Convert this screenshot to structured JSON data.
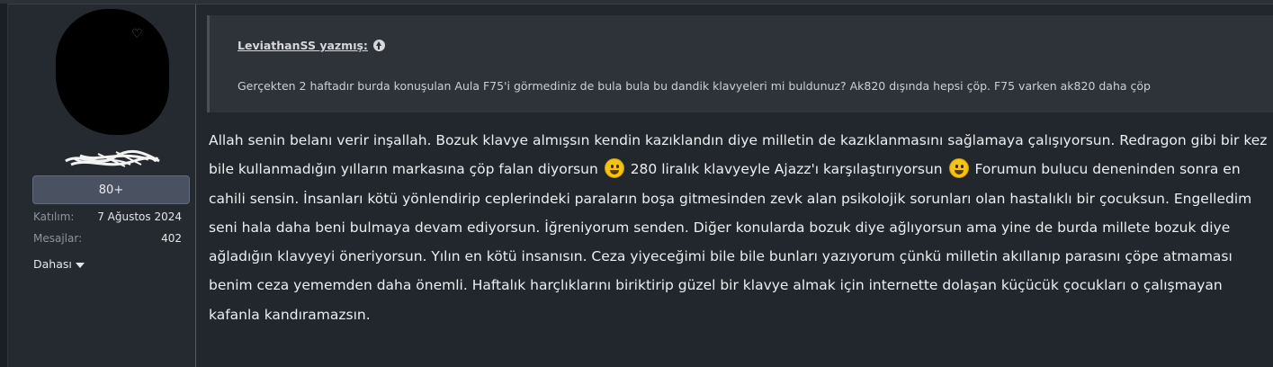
{
  "user": {
    "badge": "80+",
    "stats": [
      {
        "label": "Katılım:",
        "value": "7 Ağustos 2024"
      },
      {
        "label": "Mesajlar:",
        "value": "402"
      }
    ],
    "more_label": "Dahası"
  },
  "quote": {
    "author": "LeviathanSS yazmış:",
    "text": "Gerçekten 2 haftadır burda konuşulan Aula F75'i görmediniz de bula bula bu dandik klavyeleri mi buldunuz? Ak820 dışında hepsi çöp. F75 varken ak820 daha çöp"
  },
  "post": {
    "part1": "Allah senin belanı verir inşallah. Bozuk klavye almışsın kendin kazıklandın diye milletin de kazıklanmasını sağlamaya çalışıyorsun. Redragon gibi bir kez bile kullanmadığın yılların markasına çöp falan diyorsun",
    "part2": "280 liralık klavyeyle Ajazz'ı karşılaştırıyorsun",
    "part3": "Forumun bulucu deneninden sonra en cahili sensin. İnsanları kötü yönlendirip ceplerindeki paraların boşa gitmesinden zevk alan psikolojik sorunları olan hastalıklı bir çocuksun. Engelledim seni hala daha beni bulmaya devam ediyorsun. İğreniyorum senden. Diğer konularda bozuk diye ağlıyorsun ama yine de burda millete bozuk diye ağladığın klavyeyi öneriyorsun. Yılın en kötü insanısın. Ceza yiyeceğimi bile bile bunları yazıyorum çünkü milletin akıllanıp parasını çöpe atmaması benim ceza yememden daha önemli. Haftalık harçlıklarını biriktirip güzel bir klavye almak için internette dolaşan küçücük çocukları o çalışmayan kafanla kandıramazsın.",
    "emoji_1": "grinning-face-emoji",
    "emoji_2": "grinning-face-emoji"
  }
}
